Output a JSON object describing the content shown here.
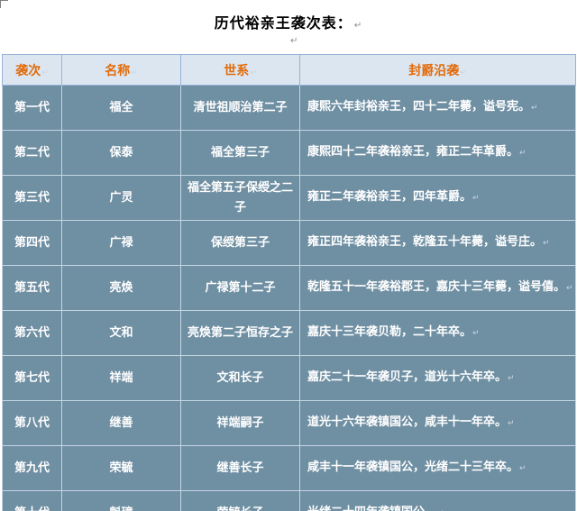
{
  "document": {
    "title": "历代裕亲王袭次表：",
    "para_mark": "↵",
    "cell_mark": "↵"
  },
  "table": {
    "headers": [
      "袭次",
      "名称",
      "世系",
      "封爵沿袭"
    ],
    "rows": [
      {
        "gen": "第一代",
        "name": "福全",
        "lineage": "清世祖顺治第二子",
        "desc": "康熙六年封裕亲王，四十二年薨，谥号宪。"
      },
      {
        "gen": "第二代",
        "name": "保泰",
        "lineage": "福全第三子",
        "desc": "康熙四十二年袭裕亲王，雍正二年革爵。"
      },
      {
        "gen": "第三代",
        "name": "广灵",
        "lineage": "福全第五子保绶之二子",
        "desc": "雍正二年袭裕亲王，四年革爵。"
      },
      {
        "gen": "第四代",
        "name": "广禄",
        "lineage": "保绶第三子",
        "desc": "雍正四年袭裕亲王，乾隆五十年薨，谥号庄。"
      },
      {
        "gen": "第五代",
        "name": "亮焕",
        "lineage": "广禄第十二子",
        "desc": "乾隆五十一年袭裕郡王，嘉庆十三年薨，谥号僖。"
      },
      {
        "gen": "第六代",
        "name": "文和",
        "lineage": "亮焕第二子恒存之子",
        "desc": "嘉庆十三年袭贝勒，二十年卒。"
      },
      {
        "gen": "第七代",
        "name": "祥端",
        "lineage": "文和长子",
        "desc": "嘉庆二十一年袭贝子，道光十六年卒。"
      },
      {
        "gen": "第八代",
        "name": "继善",
        "lineage": "祥端嗣子",
        "desc": "道光十六年袭镇国公，咸丰十一年卒。"
      },
      {
        "gen": "第九代",
        "name": "荣毓",
        "lineage": "继善长子",
        "desc": "咸丰十一年袭镇国公，光绪二十三年卒。"
      },
      {
        "gen": "第十代",
        "name": "魁璋",
        "lineage": "荣毓长子",
        "desc": "光绪二十四年袭镇国公。"
      }
    ]
  }
}
